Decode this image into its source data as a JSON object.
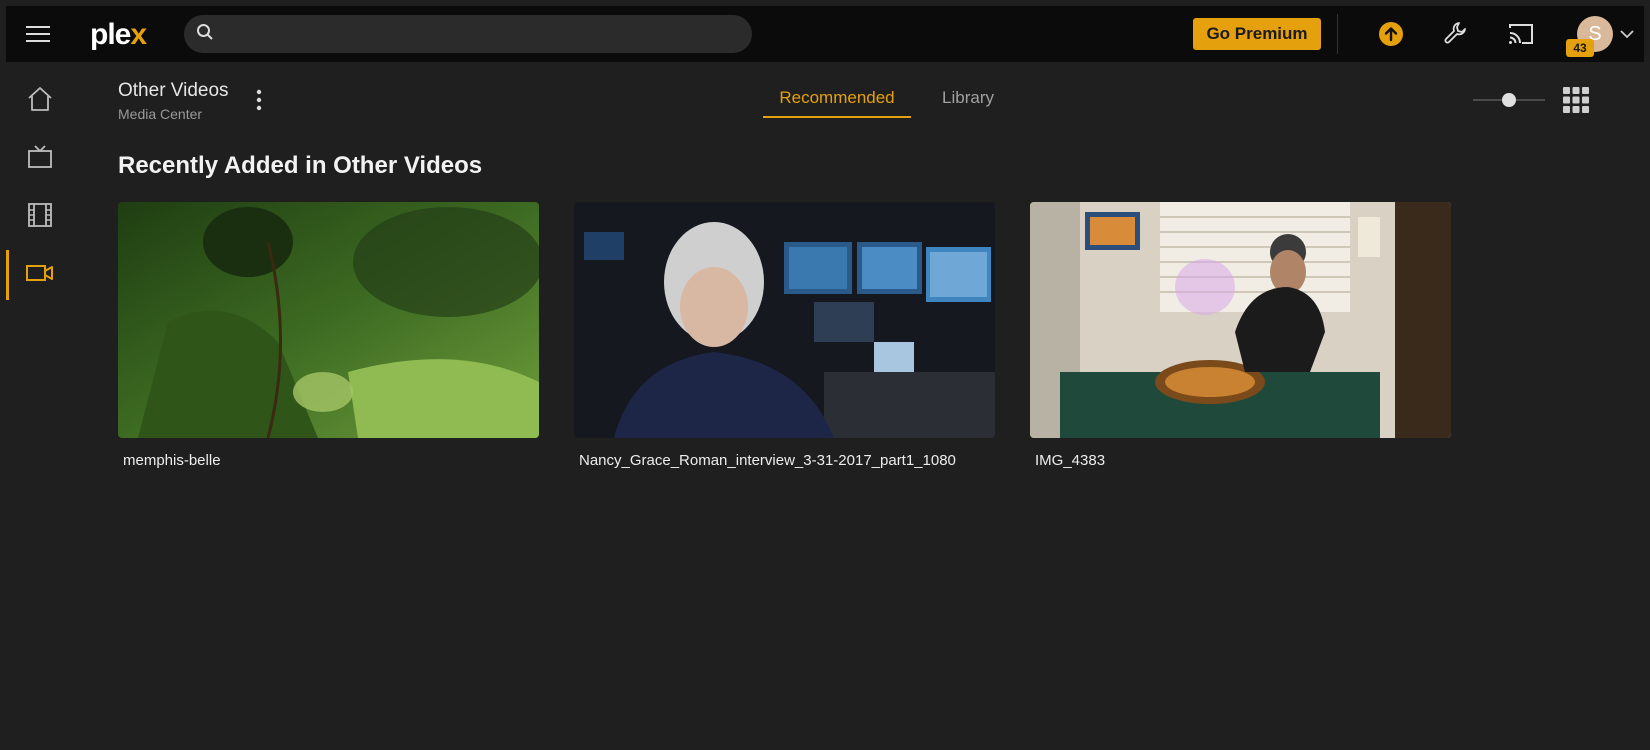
{
  "app": {
    "logo_main": "ple",
    "logo_accent": "x"
  },
  "search": {
    "placeholder": "",
    "value": ""
  },
  "header": {
    "premium_label": "Go Premium",
    "notification_count": "43",
    "avatar_initial": "S"
  },
  "sidebar": {
    "items": [
      {
        "name": "home",
        "active": false
      },
      {
        "name": "tv",
        "active": false
      },
      {
        "name": "movies",
        "active": false
      },
      {
        "name": "other-videos",
        "active": true
      }
    ]
  },
  "library": {
    "title": "Other Videos",
    "subtitle": "Media Center"
  },
  "tabs": [
    {
      "label": "Recommended",
      "active": true
    },
    {
      "label": "Library",
      "active": false
    }
  ],
  "size_slider": {
    "level": 0.5
  },
  "section": {
    "title": "Recently Added in Other Videos",
    "items": [
      {
        "title": "memphis-belle"
      },
      {
        "title": "Nancy_Grace_Roman_interview_3-31-2017_part1_1080"
      },
      {
        "title": "IMG_4383"
      }
    ]
  },
  "colors": {
    "accent": "#e5a00d",
    "background": "#1f1f1f",
    "topbar": "#0b0b0b"
  }
}
